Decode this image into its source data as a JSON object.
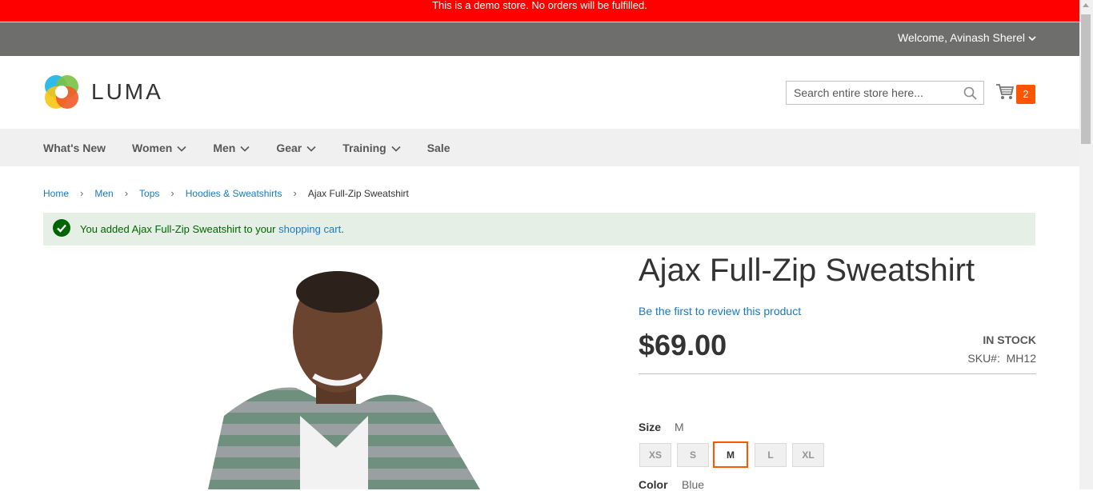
{
  "demo_notice": "This is a demo store. No orders will be fulfilled.",
  "header": {
    "welcome": "Welcome, Avinash Sherel",
    "logo_text": "LUMA",
    "search_placeholder": "Search entire store here...",
    "cart_count": "2"
  },
  "nav": {
    "items": [
      {
        "label": "What's New"
      },
      {
        "label": "Women"
      },
      {
        "label": "Men"
      },
      {
        "label": "Gear"
      },
      {
        "label": "Training"
      },
      {
        "label": "Sale"
      }
    ]
  },
  "breadcrumbs": {
    "items": [
      "Home",
      "Men",
      "Tops",
      "Hoodies & Sweatshirts"
    ],
    "current": "Ajax Full-Zip Sweatshirt"
  },
  "message": {
    "prefix": "You added Ajax Full-Zip Sweatshirt to your ",
    "link": "shopping cart",
    "suffix": "."
  },
  "product": {
    "title": "Ajax Full-Zip Sweatshirt",
    "review_link": "Be the first to review this product",
    "price": "$69.00",
    "stock": "IN STOCK",
    "sku_label": "SKU#:",
    "sku": "MH12",
    "size_label": "Size",
    "size_value": "M",
    "sizes": [
      "XS",
      "S",
      "M",
      "L",
      "XL"
    ],
    "selected_size": "M",
    "color_label": "Color",
    "color_value": "Blue"
  },
  "colors": {
    "demo_bar": "#ff0000",
    "accent": "#ff5501",
    "link": "#1979c3",
    "success": "#006400"
  }
}
